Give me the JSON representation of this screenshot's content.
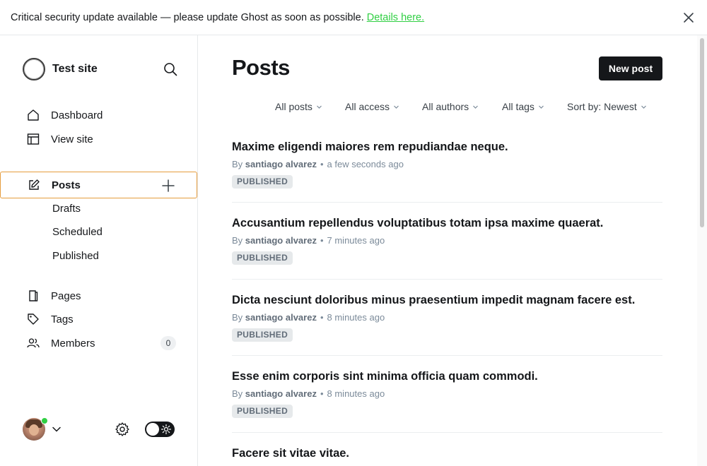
{
  "banner": {
    "message": "Critical security update available — please update Ghost as soon as possible.",
    "link_text": "Details here."
  },
  "sidebar": {
    "site_title": "Test site",
    "nav_top": [
      {
        "label": "Dashboard",
        "icon": "home-icon"
      },
      {
        "label": "View site",
        "icon": "view-site-icon"
      }
    ],
    "posts": {
      "label": "Posts",
      "icon": "edit-icon"
    },
    "post_subitems": [
      {
        "label": "Drafts"
      },
      {
        "label": "Scheduled"
      },
      {
        "label": "Published"
      }
    ],
    "nav_bottom": [
      {
        "label": "Pages",
        "icon": "pages-icon"
      },
      {
        "label": "Tags",
        "icon": "tag-icon"
      },
      {
        "label": "Members",
        "icon": "members-icon",
        "count": "0"
      }
    ]
  },
  "main": {
    "title": "Posts",
    "new_post_label": "New post",
    "filters": [
      {
        "label": "All posts"
      },
      {
        "label": "All access"
      },
      {
        "label": "All authors"
      },
      {
        "label": "All tags"
      },
      {
        "label": "Sort by: Newest"
      }
    ],
    "posts": [
      {
        "title": "Maxime eligendi maiores rem repudiandae neque.",
        "by": "By",
        "author": "santiago alvarez",
        "time": "a few seconds ago",
        "status": "PUBLISHED"
      },
      {
        "title": "Accusantium repellendus voluptatibus totam ipsa maxime quaerat.",
        "by": "By",
        "author": "santiago alvarez",
        "time": "7 minutes ago",
        "status": "PUBLISHED"
      },
      {
        "title": "Dicta nesciunt doloribus minus praesentium impedit magnam facere est.",
        "by": "By",
        "author": "santiago alvarez",
        "time": "8 minutes ago",
        "status": "PUBLISHED"
      },
      {
        "title": "Esse enim corporis sint minima officia quam commodi.",
        "by": "By",
        "author": "santiago alvarez",
        "time": "8 minutes ago",
        "status": "PUBLISHED"
      },
      {
        "title": "Facere sit vitae vitae."
      }
    ]
  },
  "colors": {
    "accent_link": "#30cf43",
    "active_border": "#e59c3d",
    "primary_button": "#15171a",
    "online": "#30cf43"
  }
}
